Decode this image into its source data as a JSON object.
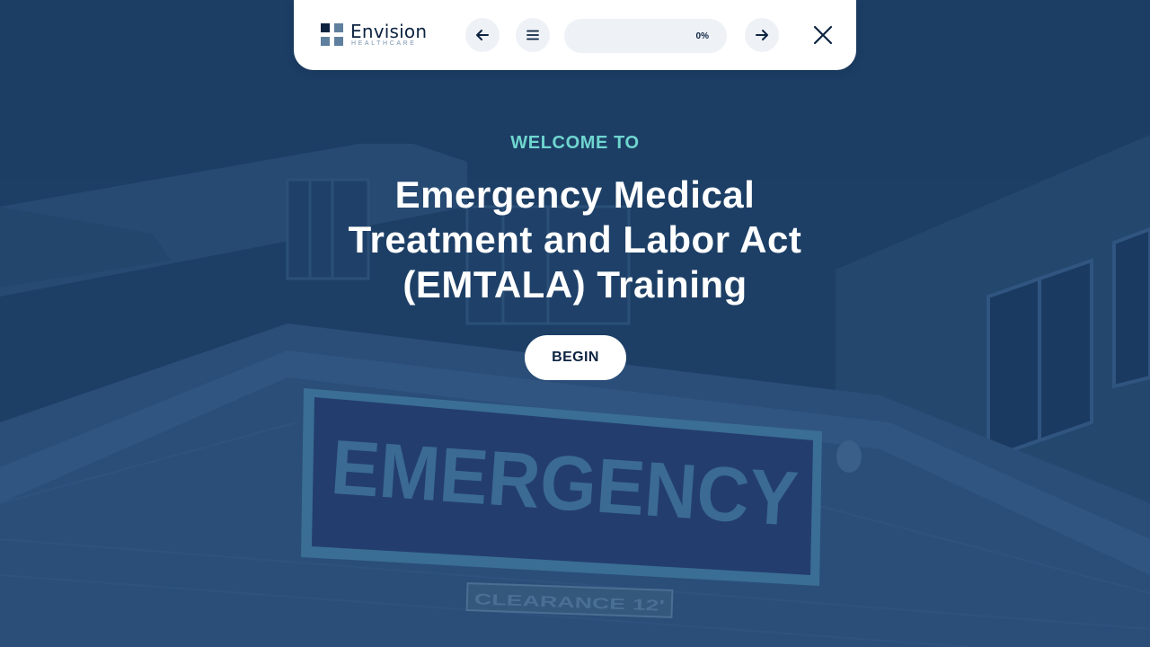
{
  "brand": {
    "name": "Envision",
    "tagline": "HEALTHCARE",
    "logo_colors": [
      "#0c2340",
      "#0c2340",
      "#5f7f9e",
      "#5f7f9e"
    ]
  },
  "nav": {
    "back_icon": "arrow-left-icon",
    "menu_icon": "hamburger-menu-icon",
    "next_icon": "arrow-right-icon",
    "close_icon": "close-icon",
    "progress": {
      "label": "0%",
      "value": 0
    }
  },
  "hero": {
    "eyebrow": "WELCOME TO",
    "title_lines": [
      "Emergency Medical",
      "Treatment and Labor Act",
      "(EMTALA) Training"
    ],
    "begin_label": "BEGIN"
  },
  "background": {
    "sign_text": "EMERGENCY",
    "clearance_text": "CLEARANCE 12'"
  },
  "colors": {
    "overlay": "#1d3f66",
    "accent": "#6fd6cf",
    "navy": "#0c2340",
    "button_bg": "#eef1f6"
  }
}
